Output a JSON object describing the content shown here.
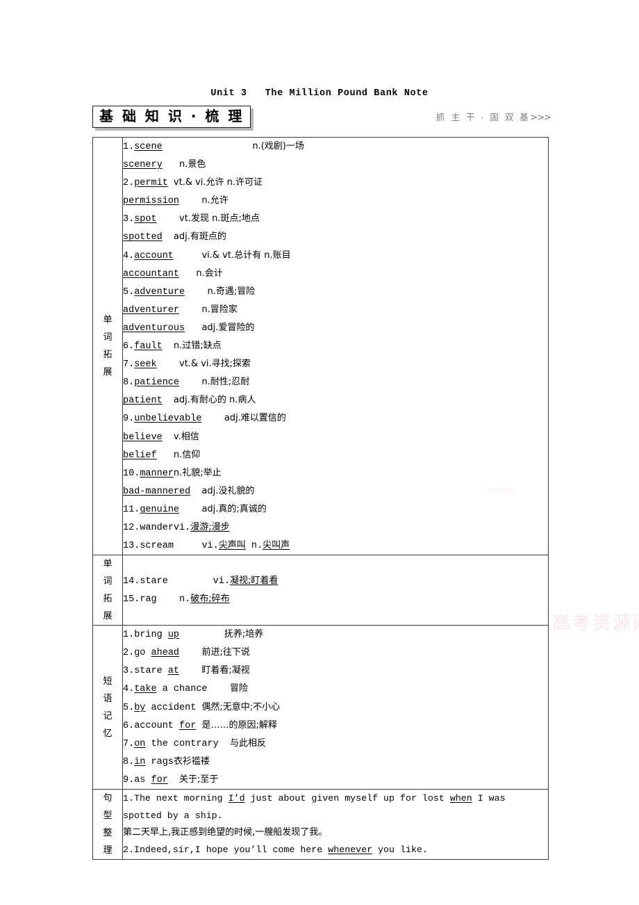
{
  "header": {
    "unit_title": "Unit 3   The Million Pound Bank Note",
    "section_box": "基 础 知 识 · 梳 理",
    "section_right": "抓 主 干 · 固 双 基",
    "section_right_arrows": ">>>"
  },
  "watermark": "高考资源网",
  "labels": {
    "word_expansion": "单词拓展",
    "word_expansion_2": "单词拓展",
    "phrase_memory": "短语记忆",
    "sentence_patterns": "句型整理"
  },
  "word_expansion_1": [
    {
      "num": "1.",
      "word": "scene",
      "word_underline": true,
      "gap": "                ",
      "meaning": "n.(戏剧)一场",
      "meaning_underline": false
    },
    {
      "num": "",
      "word": "scenery",
      "word_underline": true,
      "gap": "   ",
      "meaning": "n.景色",
      "meaning_underline": false
    },
    {
      "num": "2.",
      "word": "permit",
      "word_underline": true,
      "gap": " ",
      "meaning": "vt.& vi.允许 n.许可证",
      "meaning_underline": false
    },
    {
      "num": "",
      "word": "permission",
      "word_underline": true,
      "gap": "    ",
      "meaning": "n.允许",
      "meaning_underline": false
    },
    {
      "num": "3.",
      "word": "spot",
      "word_underline": true,
      "gap": "    ",
      "meaning": "vt.发现 n.斑点;地点",
      "meaning_underline": false
    },
    {
      "num": "",
      "word": "spotted",
      "word_underline": true,
      "gap": "  ",
      "meaning": "adj.有斑点的",
      "meaning_underline": false
    },
    {
      "num": "4.",
      "word": "account",
      "word_underline": true,
      "gap": "     ",
      "meaning": "vi.& vt.总计有 n.账目",
      "meaning_underline": false
    },
    {
      "num": "",
      "word": "accountant",
      "word_underline": true,
      "gap": "   ",
      "meaning": "n.会计",
      "meaning_underline": false
    },
    {
      "num": "5.",
      "word": "adventure",
      "word_underline": true,
      "gap": "    ",
      "meaning": "n.奇遇;冒险",
      "meaning_underline": false
    },
    {
      "num": "",
      "word": "adventurer",
      "word_underline": true,
      "gap": "    ",
      "meaning": "n.冒险家",
      "meaning_underline": false
    },
    {
      "num": "",
      "word": "adventurous",
      "word_underline": true,
      "gap": "   ",
      "meaning": "adj.爱冒险的",
      "meaning_underline": false
    },
    {
      "num": "6.",
      "word": "fault",
      "word_underline": true,
      "gap": "  ",
      "meaning": "n.过错;缺点",
      "meaning_underline": false
    },
    {
      "num": "7.",
      "word": "seek",
      "word_underline": true,
      "gap": "    ",
      "meaning": "vt.& vi.寻找;探索",
      "meaning_underline": false
    },
    {
      "num": "8.",
      "word": "patience",
      "word_underline": true,
      "gap": "    ",
      "meaning": "n.耐性;忍耐",
      "meaning_underline": false
    },
    {
      "num": "",
      "word": "patient",
      "word_underline": true,
      "gap": "  ",
      "meaning": "adj.有耐心的 n.病人",
      "meaning_underline": false
    },
    {
      "num": "9.",
      "word": "unbelievable",
      "word_underline": true,
      "gap": "    ",
      "meaning": "adj.难以置信的",
      "meaning_underline": false
    },
    {
      "num": "",
      "word": "believe",
      "word_underline": true,
      "gap": "  ",
      "meaning": "v.相信",
      "meaning_underline": false
    },
    {
      "num": "",
      "word": "belief",
      "word_underline": true,
      "gap": "   ",
      "meaning": "n.信仰",
      "meaning_underline": false
    },
    {
      "num": "10.",
      "word": "manner",
      "word_underline": true,
      "gap": "",
      "meaning": "n.礼貌;举止",
      "meaning_underline": false
    },
    {
      "num": "",
      "word": "bad-mannered",
      "word_underline": true,
      "gap": "  ",
      "meaning": "adj.没礼貌的",
      "meaning_underline": false
    },
    {
      "num": "11.",
      "word": "genuine",
      "word_underline": true,
      "gap": "    ",
      "meaning": "adj.真的;真诚的",
      "meaning_underline": false
    },
    {
      "num": "12.",
      "word": "wander",
      "word_underline": false,
      "gap": "",
      "meaning_pre": "vi.",
      "meaning": "漫游;漫步",
      "meaning_underline": true
    },
    {
      "num": "13.",
      "word": "scream",
      "word_underline": false,
      "gap": "     ",
      "meaning_pre": "vi.",
      "meaning": "尖声叫",
      "meaning_underline": true,
      "meaning_post": " n.",
      "meaning2": "尖叫声",
      "meaning2_underline": true
    }
  ],
  "word_expansion_2_items": [
    {
      "num": "14.",
      "word": "stare",
      "word_underline": false,
      "gap": "        ",
      "meaning_pre": "vi.",
      "meaning": "凝视;盯着看",
      "meaning_underline": true
    },
    {
      "num": "15.",
      "word": "rag",
      "word_underline": false,
      "gap": "    ",
      "meaning_pre": "n.",
      "meaning": "破布;碎布",
      "meaning_underline": true
    }
  ],
  "phrases": [
    {
      "num": "1.",
      "pre": "bring ",
      "key": "up",
      "post": "",
      "gap": "        ",
      "meaning": "抚养;培养"
    },
    {
      "num": "2.",
      "pre": "go ",
      "key": "ahead",
      "post": "",
      "gap": "    ",
      "meaning": "前进;往下说"
    },
    {
      "num": "3.",
      "pre": "stare ",
      "key": "at",
      "post": "",
      "gap": "    ",
      "meaning": "盯着看;凝视"
    },
    {
      "num": "4.",
      "pre": "",
      "key": "take",
      "post": " a chance",
      "gap": "    ",
      "meaning": "冒险"
    },
    {
      "num": "5.",
      "pre": "",
      "key": "by",
      "post": " accident ",
      "gap": "",
      "meaning": "偶然;无意中;不小心"
    },
    {
      "num": "6.",
      "pre": "account ",
      "key": "for",
      "post": " ",
      "gap": "",
      "meaning": "是……的原因;解释"
    },
    {
      "num": "7.",
      "pre": "",
      "key": "on",
      "post": " the contrary ",
      "gap": " ",
      "meaning": "与此相反"
    },
    {
      "num": "8.",
      "pre": "",
      "key": "in",
      "post": " rags",
      "gap": "",
      "meaning": "衣衫褴褛"
    },
    {
      "num": "9.",
      "pre": "as ",
      "key": "for",
      "post": " ",
      "gap": " ",
      "meaning": "关于;至于"
    }
  ],
  "sentences": [
    {
      "num": "1.",
      "en_pre": "The next morning ",
      "en_key1": "I’d",
      "en_mid": " just about given myself up for lost ",
      "en_key2": "when",
      "en_post": " I was spotted by a ship.",
      "cn": "第二天早上,我正感到绝望的时候,一艘船发现了我。"
    },
    {
      "num": "2.",
      "en_pre": "Indeed,sir,I hope you’ll come here ",
      "en_key1": "whenever",
      "en_mid": "",
      "en_key2": "",
      "en_post": " you like.",
      "cn": ""
    }
  ]
}
